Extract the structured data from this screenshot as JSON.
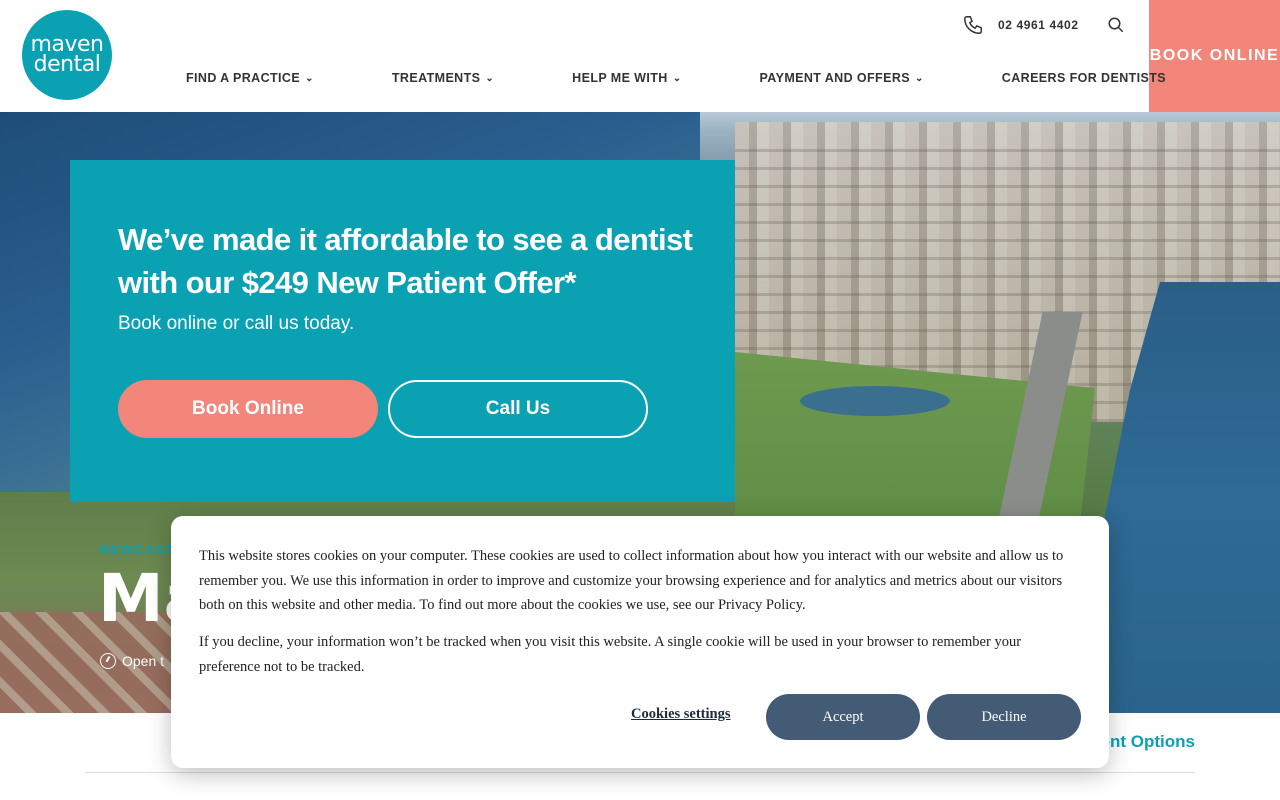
{
  "header": {
    "logo": {
      "line1": "maven",
      "line2": "dental"
    },
    "phone": "02 4961 4402",
    "book_online": "BOOK ONLINE",
    "nav": [
      {
        "label": "FIND A PRACTICE",
        "has_dropdown": true
      },
      {
        "label": "TREATMENTS",
        "has_dropdown": true
      },
      {
        "label": "HELP ME WITH",
        "has_dropdown": true
      },
      {
        "label": "PAYMENT AND OFFERS",
        "has_dropdown": true
      },
      {
        "label": "CAREERS FOR DENTISTS",
        "has_dropdown": false
      }
    ]
  },
  "promo": {
    "title": "We’ve made it affordable to see a dentist with our $249 New Patient Offer*",
    "subtitle": "Book online or call us today.",
    "book_button": "Book Online",
    "call_button": "Call Us"
  },
  "page": {
    "location_eyebrow": "NEWCASTL",
    "practice_name": "Ma",
    "open_status": "Open t",
    "payment_link": "ent Options"
  },
  "cookie": {
    "text1": "This website stores cookies on your computer. These cookies are used to collect information about how you interact with our website and allow us to remember you. We use this information in order to improve and customize your browsing experience and for analytics and metrics about our visitors both on this website and other media. To find out more about the cookies we use, see our Privacy Policy.",
    "text2": "If you decline, your information won’t be tracked when you visit this website. A single cookie will be used in your browser to remember your preference not to be tracked.",
    "settings_label": "Cookies settings",
    "accept_label": "Accept",
    "decline_label": "Decline"
  },
  "colors": {
    "teal": "#0aa2b3",
    "coral": "#f2867a",
    "slate_button": "#435b74"
  },
  "icons": [
    "phone-icon",
    "search-icon",
    "chevron-down-icon",
    "clock-icon"
  ]
}
